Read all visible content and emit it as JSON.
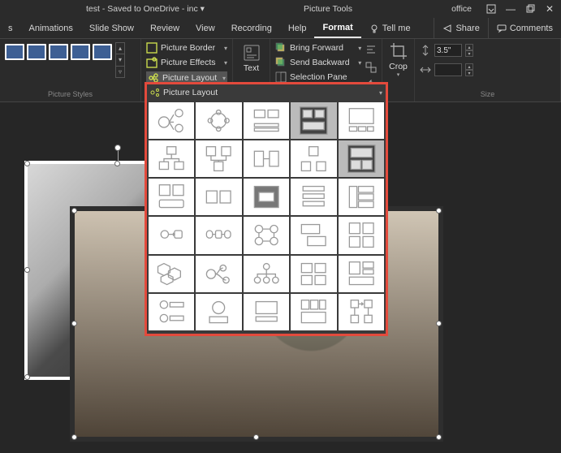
{
  "titlebar": {
    "doc": "test  -  Saved to OneDrive  -  inc ▾",
    "context_tab": "Picture Tools",
    "office_label": "office"
  },
  "tabs": {
    "list": [
      "s",
      "Animations",
      "Slide Show",
      "Review",
      "View",
      "Recording",
      "Help",
      "Format"
    ],
    "active_index": 7,
    "tell_me": "Tell me",
    "share": "Share",
    "comments": "Comments"
  },
  "ribbon": {
    "picture_styles_label": "Picture Styles",
    "picture_border": "Picture Border",
    "picture_effects": "Picture Effects",
    "picture_layout": "Picture Layout",
    "acc_text": "Text",
    "bring_forward": "Bring Forward",
    "send_backward": "Send Backward",
    "selection_pane": "Selection Pane",
    "crop": "Crop",
    "height_value": "3.5\"",
    "width_value": "",
    "size_label": "Size"
  },
  "layout_panel": {
    "title": "Picture Layout"
  },
  "chart_data": null
}
